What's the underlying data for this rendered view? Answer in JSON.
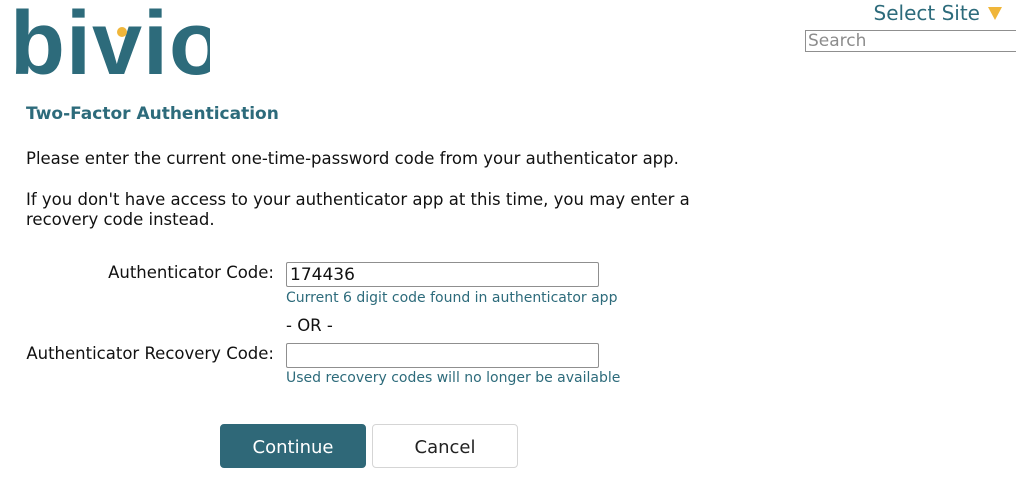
{
  "header": {
    "logo_text": "bivio",
    "select_site_label": "Select Site",
    "search": {
      "placeholder": "Search",
      "value": ""
    }
  },
  "colors": {
    "accent": "#2d6b7b",
    "select_arrow": "#f0b63a",
    "button_primary": "#2f6878"
  },
  "icons": {
    "site_select": "triangle-down-icon"
  },
  "page": {
    "title": "Two-Factor Authentication",
    "instruction": "Please enter the current one-time-password code from your authenticator app.",
    "recovery_instruction": "If you don't have access to your authenticator app at this time, you may enter a recovery code instead."
  },
  "form": {
    "authenticator": {
      "label": "Authenticator Code:",
      "value": "174436",
      "hint": "Current 6 digit code found in authenticator app"
    },
    "separator": "- OR -",
    "recovery": {
      "label": "Authenticator Recovery Code:",
      "value": "",
      "hint": "Used recovery codes will no longer be available"
    }
  },
  "actions": {
    "continue_label": "Continue",
    "cancel_label": "Cancel"
  }
}
